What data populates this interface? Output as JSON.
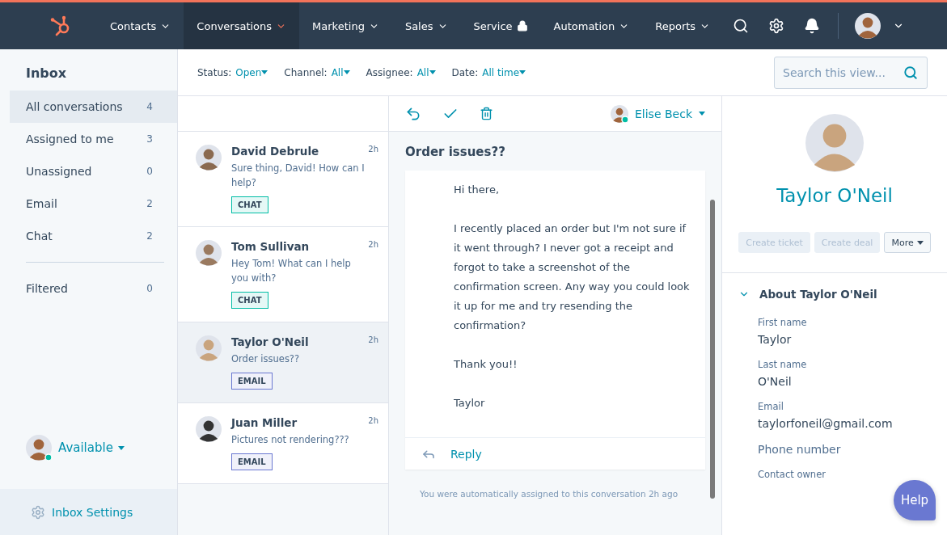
{
  "nav": {
    "items": [
      {
        "label": "Contacts",
        "selected": false,
        "locked": false
      },
      {
        "label": "Conversations",
        "selected": true,
        "locked": false
      },
      {
        "label": "Marketing",
        "selected": false,
        "locked": false
      },
      {
        "label": "Sales",
        "selected": false,
        "locked": false
      },
      {
        "label": "Service",
        "selected": false,
        "locked": true
      },
      {
        "label": "Automation",
        "selected": false,
        "locked": false
      },
      {
        "label": "Reports",
        "selected": false,
        "locked": false
      }
    ]
  },
  "sidebar": {
    "title": "Inbox",
    "items": [
      {
        "label": "All conversations",
        "count": "4",
        "selected": true
      },
      {
        "label": "Assigned to me",
        "count": "3",
        "selected": false
      },
      {
        "label": "Unassigned",
        "count": "0",
        "selected": false
      },
      {
        "label": "Email",
        "count": "2",
        "selected": false
      },
      {
        "label": "Chat",
        "count": "2",
        "selected": false
      }
    ],
    "filters": [
      {
        "label": "Filtered",
        "count": "0",
        "selected": false
      }
    ],
    "status": {
      "label": "Available",
      "online": true
    },
    "settings": "Inbox Settings"
  },
  "filters": [
    {
      "label": "Status:",
      "value": "Open"
    },
    {
      "label": "Channel:",
      "value": "All"
    },
    {
      "label": "Assignee:",
      "value": "All"
    },
    {
      "label": "Date:",
      "value": "All time"
    }
  ],
  "search": {
    "placeholder": "Search this view..."
  },
  "conversations": [
    {
      "name": "David Debrule",
      "time": "2h",
      "preview": "Sure thing, David! How can I help?",
      "tag": "CHAT",
      "kind": "chat",
      "selected": false
    },
    {
      "name": "Tom Sullivan",
      "time": "2h",
      "preview": "Hey Tom! What can I help you with?",
      "tag": "CHAT",
      "kind": "chat",
      "selected": false
    },
    {
      "name": "Taylor O'Neil",
      "time": "2h",
      "preview": "Order issues??",
      "tag": "EMAIL",
      "kind": "email",
      "selected": true
    },
    {
      "name": "Juan Miller",
      "time": "2h",
      "preview": "Pictures not rendering???",
      "tag": "EMAIL",
      "kind": "email",
      "selected": false
    }
  ],
  "thread": {
    "assignee": {
      "name": "Elise Beck",
      "online": true
    },
    "subject": "Order issues??",
    "paragraphs": [
      "Hi there,",
      "I recently placed an order but I'm not sure if it went through? I never got a receipt and forgot to take a screenshot of the confirmation screen. Any way you could look it up for me and try resending the confirmation?",
      "Thank you!!",
      "Taylor"
    ],
    "reply": "Reply",
    "note": "You were automatically assigned to this conversation 2h ago"
  },
  "contact": {
    "name": "Taylor O'Neil",
    "buttons": [
      {
        "label": "Create ticket",
        "disabled": true,
        "dropdown": false
      },
      {
        "label": "Create deal",
        "disabled": true,
        "dropdown": false
      },
      {
        "label": "More",
        "disabled": false,
        "dropdown": true
      }
    ],
    "section": {
      "title": "About Taylor O'Neil",
      "expanded": true
    },
    "fields": [
      {
        "label": "First name",
        "value": "Taylor"
      },
      {
        "label": "Last name",
        "value": "O'Neil"
      },
      {
        "label": "Email",
        "value": "taylorfoneil@gmail.com"
      },
      {
        "label": "Phone number"
      },
      {
        "label": "Contact owner"
      }
    ]
  },
  "help": "Help"
}
